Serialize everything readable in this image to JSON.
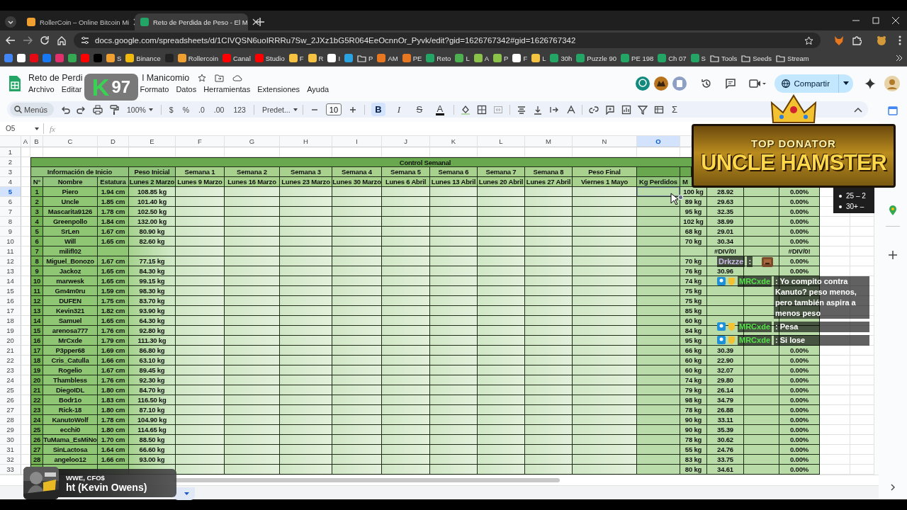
{
  "browser": {
    "tabs": [
      {
        "title": "RollerCoin – Online Bitcoin Mi",
        "selected": false,
        "color": "#f0a030"
      },
      {
        "title": "Reto de Perdida de Peso - El M",
        "selected": true,
        "color": "#23a566"
      }
    ],
    "url": "docs.google.com/spreadsheets/d/1CIVQSN6uoIRRRu7Sw_2JXz1bG5R064EeOcnnOr_Pyvk/edit?gid=1626767342#gid=1626767342",
    "bookmarks": [
      {
        "kind": "site",
        "color": "#4285f4"
      },
      {
        "kind": "site",
        "color": "#ffffff"
      },
      {
        "kind": "site",
        "color": "#e50914"
      },
      {
        "kind": "site",
        "color": "#1877f2"
      },
      {
        "kind": "site",
        "color": "#e1306c"
      },
      {
        "kind": "site",
        "color": "#34a853"
      },
      {
        "kind": "site",
        "color": "#ff0000"
      },
      {
        "kind": "site",
        "color": "#000000"
      },
      {
        "kind": "site",
        "label": "S",
        "color": "#f0a030"
      },
      {
        "kind": "site",
        "label": "Binance",
        "color": "#f0b90b"
      },
      {
        "kind": "site",
        "color": "#222222"
      },
      {
        "kind": "site",
        "label": "Rollercoin",
        "color": "#f0a030"
      },
      {
        "kind": "site",
        "label": "Canal",
        "color": "#ff0000"
      },
      {
        "kind": "site",
        "label": "Studio",
        "color": "#ff0000"
      },
      {
        "kind": "site",
        "label": "F",
        "color": "#f5c242"
      },
      {
        "kind": "site",
        "label": "R",
        "color": "#f5c242"
      },
      {
        "kind": "site",
        "label": "I",
        "color": "#ffffff"
      },
      {
        "kind": "site",
        "color": "#2aa3e0"
      },
      {
        "kind": "folder",
        "label": "P"
      },
      {
        "kind": "site",
        "label": "AM",
        "color": "#e87722"
      },
      {
        "kind": "site",
        "label": "PE",
        "color": "#e87722"
      },
      {
        "kind": "site",
        "label": "Reto",
        "color": "#23a566"
      },
      {
        "kind": "site",
        "label": "L",
        "color": "#4caf50"
      },
      {
        "kind": "site",
        "label": "A",
        "color": "#8bc34a"
      },
      {
        "kind": "site",
        "label": "P",
        "color": "#8bc34a"
      },
      {
        "kind": "site",
        "label": "F",
        "color": "#ffffff"
      },
      {
        "kind": "site",
        "label": "L",
        "color": "#f5c242"
      },
      {
        "kind": "site",
        "label": "30h",
        "color": "#23a566"
      },
      {
        "kind": "site",
        "label": "Puzzle 90",
        "color": "#23a566"
      },
      {
        "kind": "site",
        "label": "PE 198",
        "color": "#23a566"
      },
      {
        "kind": "site",
        "label": "Ch 07",
        "color": "#23a566"
      },
      {
        "kind": "site",
        "label": "S",
        "color": "#23a566"
      },
      {
        "kind": "folder",
        "label": "Tools"
      },
      {
        "kind": "folder",
        "label": "Seeds"
      },
      {
        "kind": "folder",
        "label": "Stream"
      }
    ]
  },
  "doc": {
    "title_parts": [
      "Reto de Perdi",
      "l Manicomio"
    ],
    "menu": [
      "Archivo",
      "Editar",
      "Formato",
      "Datos",
      "Herramientas",
      "Extensiones",
      "Ayuda"
    ],
    "share": "Compartir"
  },
  "toolbar": {
    "search": {
      "placeholder": "Menús"
    },
    "zoom": "100%",
    "number_formats": [
      "$",
      "%",
      ".0",
      ".00",
      "123"
    ],
    "font": "Predet...",
    "font_size": "10",
    "text_styles": [
      {
        "kind": "bold",
        "glyph": "B",
        "active": true
      },
      {
        "kind": "italic",
        "glyph": "I",
        "active": false
      },
      {
        "kind": "strike",
        "glyph": "S",
        "active": false
      },
      {
        "kind": "color",
        "glyph": "A",
        "active": false
      }
    ],
    "functions": "Σ"
  },
  "formula_bar": {
    "cell": "O5",
    "fx": "fx"
  },
  "grid": {
    "columns": [
      {
        "label": "A",
        "selected": false
      },
      {
        "label": "B",
        "selected": false
      },
      {
        "label": "C",
        "selected": false
      },
      {
        "label": "D",
        "selected": false
      },
      {
        "label": "E",
        "selected": false
      },
      {
        "label": "F",
        "selected": false
      },
      {
        "label": "G",
        "selected": false
      },
      {
        "label": "H",
        "selected": false
      },
      {
        "label": "I",
        "selected": false
      },
      {
        "label": "J",
        "selected": false
      },
      {
        "label": "K",
        "selected": false
      },
      {
        "label": "L",
        "selected": false
      },
      {
        "label": "M",
        "selected": false
      },
      {
        "label": "N",
        "selected": false
      },
      {
        "label": "O",
        "selected": true
      }
    ],
    "row_headers": [
      {
        "label": "1",
        "selected": false
      },
      {
        "label": "2",
        "selected": false
      },
      {
        "label": "3",
        "selected": false
      },
      {
        "label": "4",
        "selected": false
      },
      {
        "label": "5",
        "selected": true
      },
      {
        "label": "6",
        "selected": false
      },
      {
        "label": "7",
        "selected": false
      },
      {
        "label": "8",
        "selected": false
      },
      {
        "label": "9",
        "selected": false
      },
      {
        "label": "10",
        "selected": false
      },
      {
        "label": "11",
        "selected": false
      },
      {
        "label": "12",
        "selected": false
      },
      {
        "label": "13",
        "selected": false
      },
      {
        "label": "14",
        "selected": false
      },
      {
        "label": "15",
        "selected": false
      },
      {
        "label": "16",
        "selected": false
      },
      {
        "label": "17",
        "selected": false
      },
      {
        "label": "18",
        "selected": false
      },
      {
        "label": "19",
        "selected": false
      },
      {
        "label": "20",
        "selected": false
      },
      {
        "label": "21",
        "selected": false
      },
      {
        "label": "22",
        "selected": false
      },
      {
        "label": "23",
        "selected": false
      },
      {
        "label": "24",
        "selected": false
      },
      {
        "label": "25",
        "selected": false
      },
      {
        "label": "26",
        "selected": false
      },
      {
        "label": "27",
        "selected": false
      },
      {
        "label": "28",
        "selected": false
      },
      {
        "label": "29",
        "selected": false
      },
      {
        "label": "30",
        "selected": false
      },
      {
        "label": "31",
        "selected": false
      },
      {
        "label": "32",
        "selected": false
      },
      {
        "label": "33",
        "selected": false
      }
    ],
    "banner": "Control Semanal",
    "group_headers": [
      "Información de Inicio",
      "Peso Inicial",
      "Semana 1",
      "Semana 2",
      "Semana 3",
      "Semana 4",
      "Semana 5",
      "Semana 6",
      "Semana 7",
      "Semana 8",
      "Peso Final"
    ],
    "subheaders": [
      "N°",
      "Nombre",
      "Estatura",
      "Lunes 2 Marzo",
      "Lunes 9 Marzo",
      "Lunes 16 Marzo",
      "Lunes 23 Marzo",
      "Lunes 30 Marzo",
      "Lunes 6 Abril",
      "Lunes 13 Abril",
      "Lunes 20 Abril",
      "Lunes 27 Abril",
      "Viernes 1 Mayo",
      "Kg Perdidos",
      "M"
    ],
    "rows": [
      {
        "n": "1",
        "name": "Piero",
        "height": "1.94 cm",
        "weight": "108.85 kg",
        "goal": "100 kg",
        "imc": "28.92",
        "pct": "0.00%"
      },
      {
        "n": "2",
        "name": "Uncle",
        "height": "1.85 cm",
        "weight": "101.40 kg",
        "goal": "89 kg",
        "imc": "29.63",
        "pct": "0.00%"
      },
      {
        "n": "3",
        "name": "Mascarita9126",
        "height": "1.78 cm",
        "weight": "102.50 kg",
        "goal": "95 kg",
        "imc": "32.35",
        "pct": "0.00%"
      },
      {
        "n": "4",
        "name": "Greenpollo",
        "height": "1.84 cm",
        "weight": "132.00 kg",
        "goal": "102 kg",
        "imc": "38.99",
        "pct": "0.00%"
      },
      {
        "n": "5",
        "name": "SrLen",
        "height": "1.67 cm",
        "weight": "80.90 kg",
        "goal": "68 kg",
        "imc": "29.01",
        "pct": "0.00%"
      },
      {
        "n": "6",
        "name": "Will",
        "height": "1.65 cm",
        "weight": "82.60 kg",
        "goal": "70 kg",
        "imc": "30.34",
        "pct": "0.00%"
      },
      {
        "n": "7",
        "name": "milifl02",
        "imc": "#DIV/0!",
        "pct": "#DIV/0!"
      },
      {
        "n": "8",
        "name": "Miguel_Bonozo",
        "height": "1.67 cm",
        "weight": "77.15 kg",
        "goal": "70 kg",
        "pct": "0.00%"
      },
      {
        "n": "9",
        "name": "Jackoz",
        "height": "1.65 cm",
        "weight": "84.30 kg",
        "goal": "76 kg",
        "imc": "30.96",
        "pct": "0.00%"
      },
      {
        "n": "10",
        "name": "marwesk",
        "height": "1.65 cm",
        "weight": "99.15 kg",
        "goal": "74 kg"
      },
      {
        "n": "11",
        "name": "Gm4m0ru",
        "height": "1.59 cm",
        "weight": "98.30 kg",
        "goal": "75 kg"
      },
      {
        "n": "12",
        "name": "DUFEN",
        "height": "1.75 cm",
        "weight": "83.70 kg",
        "goal": "75 kg"
      },
      {
        "n": "13",
        "name": "Kevin321",
        "height": "1.82 cm",
        "weight": "93.90 kg",
        "goal": "85 kg"
      },
      {
        "n": "14",
        "name": "Samuel",
        "height": "1.65 cm",
        "weight": "64.30 kg",
        "goal": "60 kg"
      },
      {
        "n": "15",
        "name": "arenosa777",
        "height": "1.76 cm",
        "weight": "92.80 kg",
        "goal": "84 kg"
      },
      {
        "n": "16",
        "name": "MrCxde",
        "height": "1.79 cm",
        "weight": "111.30 kg",
        "goal": "95 kg"
      },
      {
        "n": "17",
        "name": "P3pper68",
        "height": "1.69 cm",
        "weight": "86.80 kg",
        "goal": "66 kg",
        "imc": "30.39",
        "pct": "0.00%"
      },
      {
        "n": "18",
        "name": "Cris_Catulla",
        "height": "1.66 cm",
        "weight": "63.10 kg",
        "goal": "60 kg",
        "imc": "22.90",
        "pct": "0.00%"
      },
      {
        "n": "19",
        "name": "Rogelio",
        "height": "1.67 cm",
        "weight": "89.45 kg",
        "goal": "60 kg",
        "imc": "32.07",
        "pct": "0.00%"
      },
      {
        "n": "20",
        "name": "Thambless",
        "height": "1.76 cm",
        "weight": "92.30 kg",
        "goal": "74 kg",
        "imc": "29.80",
        "pct": "0.00%"
      },
      {
        "n": "21",
        "name": "DiegoIDL",
        "height": "1.80 cm",
        "weight": "84.70 kg",
        "goal": "79 kg",
        "imc": "26.14",
        "pct": "0.00%"
      },
      {
        "n": "22",
        "name": "Bodr1o",
        "height": "1.83 cm",
        "weight": "116.50 kg",
        "goal": "98 kg",
        "imc": "34.79",
        "pct": "0.00%"
      },
      {
        "n": "23",
        "name": "Rick-18",
        "height": "1.80 cm",
        "weight": "87.10 kg",
        "goal": "78 kg",
        "imc": "26.88",
        "pct": "0.00%"
      },
      {
        "n": "24",
        "name": "KanutoWolf",
        "height": "1.78 cm",
        "weight": "104.90 kg",
        "goal": "90 kg",
        "imc": "33.11",
        "pct": "0.00%"
      },
      {
        "n": "25",
        "name": "ecchi0",
        "height": "1.80 cm",
        "weight": "114.65 kg",
        "goal": "90 kg",
        "imc": "35.39",
        "pct": "0.00%"
      },
      {
        "n": "26",
        "name": "TuMama_EsMiNo",
        "height": "1.70 cm",
        "weight": "88.50 kg",
        "goal": "78 kg",
        "imc": "30.62",
        "pct": "0.00%"
      },
      {
        "n": "27",
        "name": "SinLactosa",
        "height": "1.64 cm",
        "weight": "66.60 kg",
        "goal": "55 kg",
        "imc": "24.76",
        "pct": "0.00%"
      },
      {
        "n": "28",
        "name": "angeloo12",
        "height": "1.66 cm",
        "weight": "93.00 kg",
        "goal": "83 kg",
        "imc": "33.75",
        "pct": "0.00%"
      },
      {
        "goal": "80 kg",
        "imc": "34.61",
        "pct": "0.00%"
      }
    ]
  },
  "overlays": {
    "logo": {
      "letter": "K",
      "number": "97"
    },
    "donator": {
      "label": "TOP DONATOR",
      "name": "UNCLE HAMSTER"
    },
    "legend": [
      "25 – 2",
      "30+ –"
    ],
    "chat": [
      {
        "user": "Drkzze",
        "text": ":",
        "badges": false,
        "emote": true
      },
      {
        "user": "MRCxde",
        "text": ": Yo compito contra Kanuto? peso menos, pero también aspira a menos peso",
        "badges": true,
        "emote": false
      },
      {
        "user": "MRCxde",
        "text": ": Pesa",
        "badges": true,
        "emote": false
      },
      {
        "user": "MRCxde",
        "text": ": Si lose",
        "badges": true,
        "emote": false
      }
    ],
    "now_playing": {
      "artist": "WWE, CFO$",
      "title": "ht (Kevin Owens)"
    }
  }
}
